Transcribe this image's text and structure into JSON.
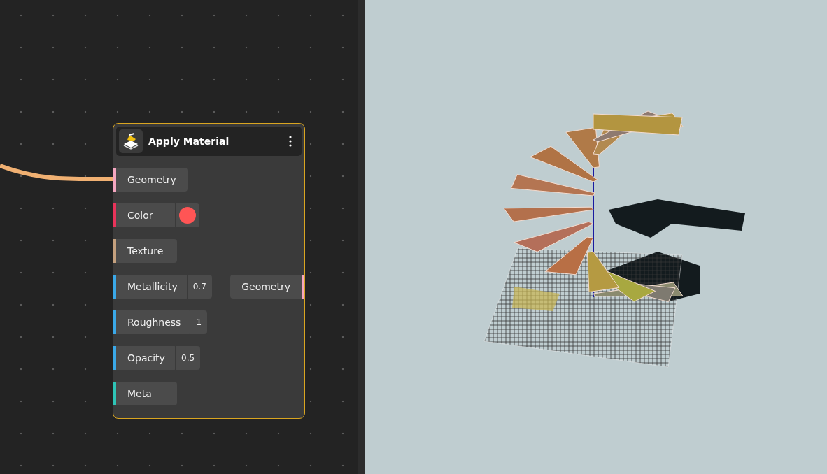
{
  "node": {
    "title": "Apply Material",
    "inputs": [
      {
        "kind": "plain",
        "label": "Geometry",
        "color": "#f4a6c0",
        "connected": true
      },
      {
        "kind": "color",
        "label": "Color",
        "color": "#e8335a",
        "swatch": {
          "color": "#ff5555"
        }
      },
      {
        "kind": "plain",
        "label": "Texture",
        "color": "#c4a07e"
      },
      {
        "kind": "number",
        "label": "Metallicity",
        "color": "#3aa8e8",
        "value": "0.7"
      },
      {
        "kind": "number",
        "label": "Roughness",
        "color": "#3aa8e8",
        "value": "1"
      },
      {
        "kind": "number",
        "label": "Opacity",
        "color": "#3aa8e8",
        "value": "0.5"
      },
      {
        "kind": "plain",
        "label": "Meta",
        "color": "#2ec4b6"
      }
    ],
    "outputs": [
      {
        "label": "Geometry",
        "color": "#f4a6c0"
      }
    ]
  }
}
